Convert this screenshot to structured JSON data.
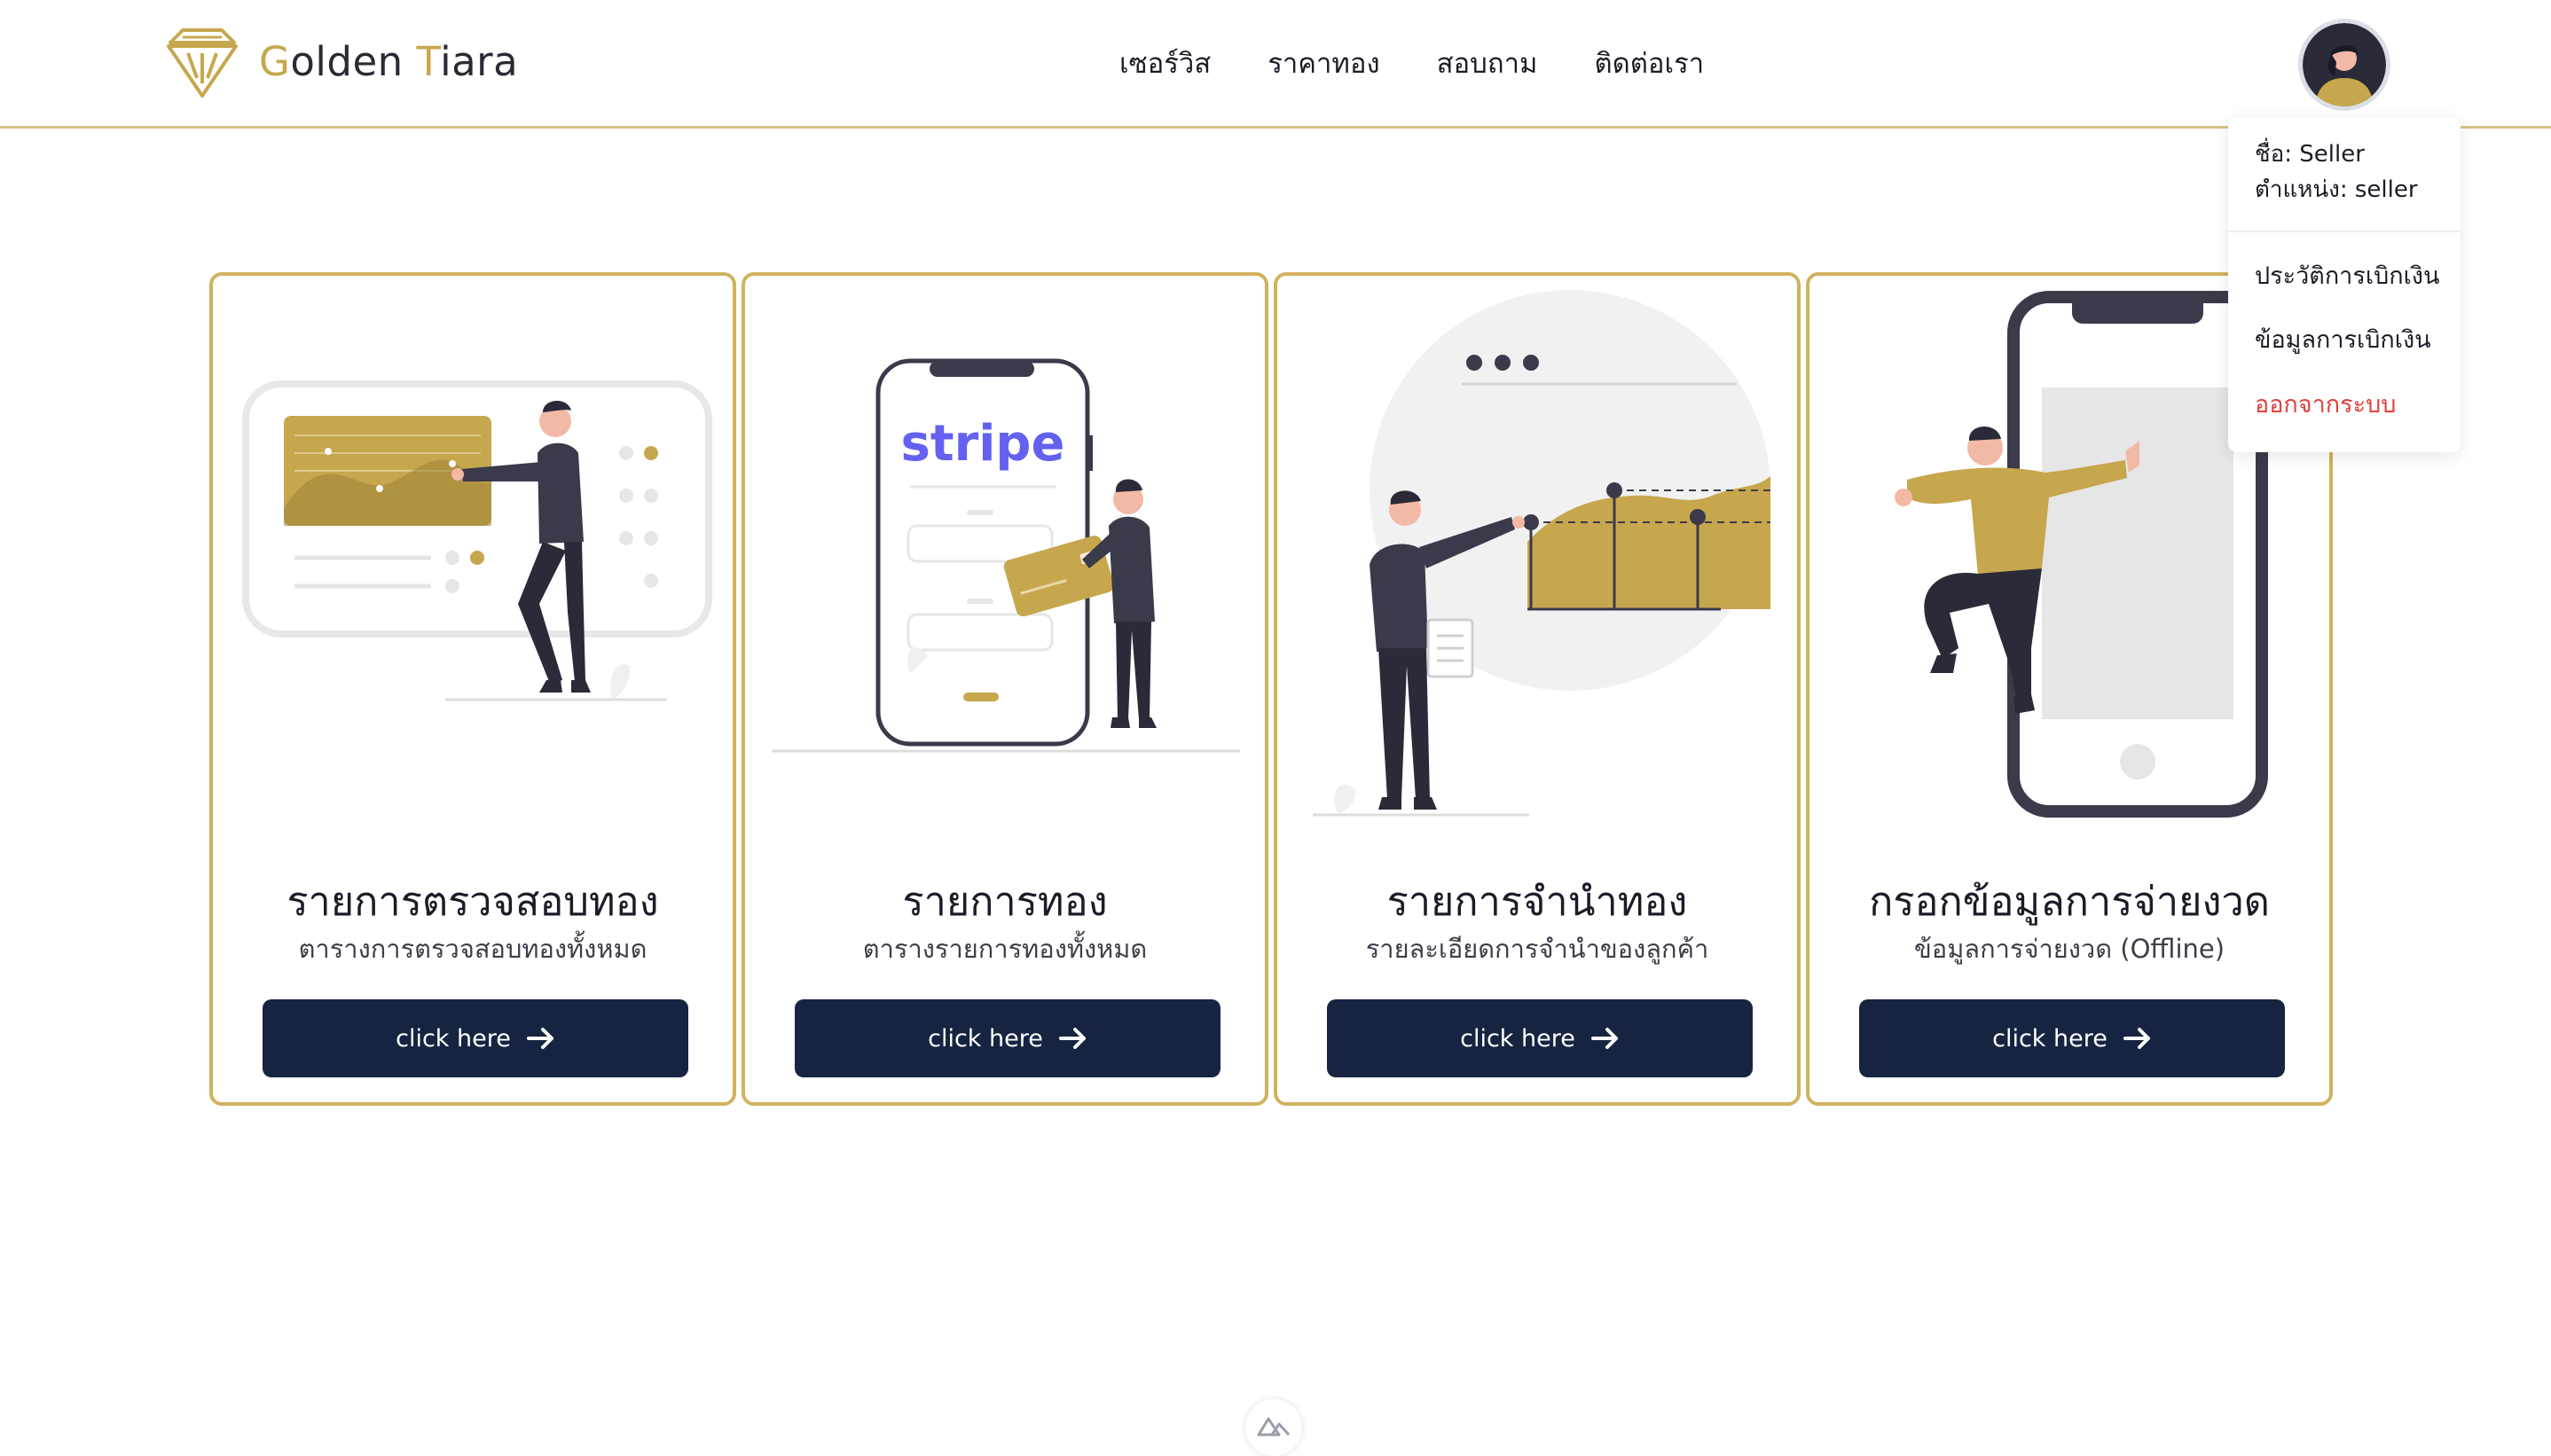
{
  "brand": {
    "first_letter": "G",
    "part1": "olden ",
    "second_letter": "T",
    "part2": "iara"
  },
  "nav": {
    "items": [
      "เซอร์วิส",
      "ราคาทอง",
      "สอบถาม",
      "ติดต่อเรา"
    ]
  },
  "user_menu": {
    "name_line": "ชื่อ: Seller",
    "role_line": "ตำแหน่ง: seller",
    "items": [
      "ประวัติการเบิกเงิน",
      "ข้อมูลการเบิกเงิน",
      "ออกจากระบบ"
    ]
  },
  "cards": [
    {
      "title": "รายการตรวจสอบทอง",
      "subtitle": "ตารางการตรวจสอบทองทั้งหมด",
      "button": "click here"
    },
    {
      "title": "รายการทอง",
      "subtitle": "ตารางรายการทองทั้งหมด",
      "button": "click here",
      "illustration_text": "stripe"
    },
    {
      "title": "รายการจำนำทอง",
      "subtitle": "รายละเอียดการจำนำของลูกค้า",
      "button": "click here"
    },
    {
      "title": "กรอกข้อมูลการจ่ายงวด",
      "subtitle": "ข้อมูลการจ่ายงวด (Offline)",
      "button": "click here"
    }
  ],
  "colors": {
    "gold": "#c6a74d",
    "navy": "#172441",
    "danger": "#e2403d",
    "border_gold": "#d1b25e"
  },
  "icons": {
    "logo": "tiara-logo-icon",
    "avatar": "user-avatar",
    "button": "arrow-right-icon",
    "badge": "nuxt-devtools-icon"
  }
}
